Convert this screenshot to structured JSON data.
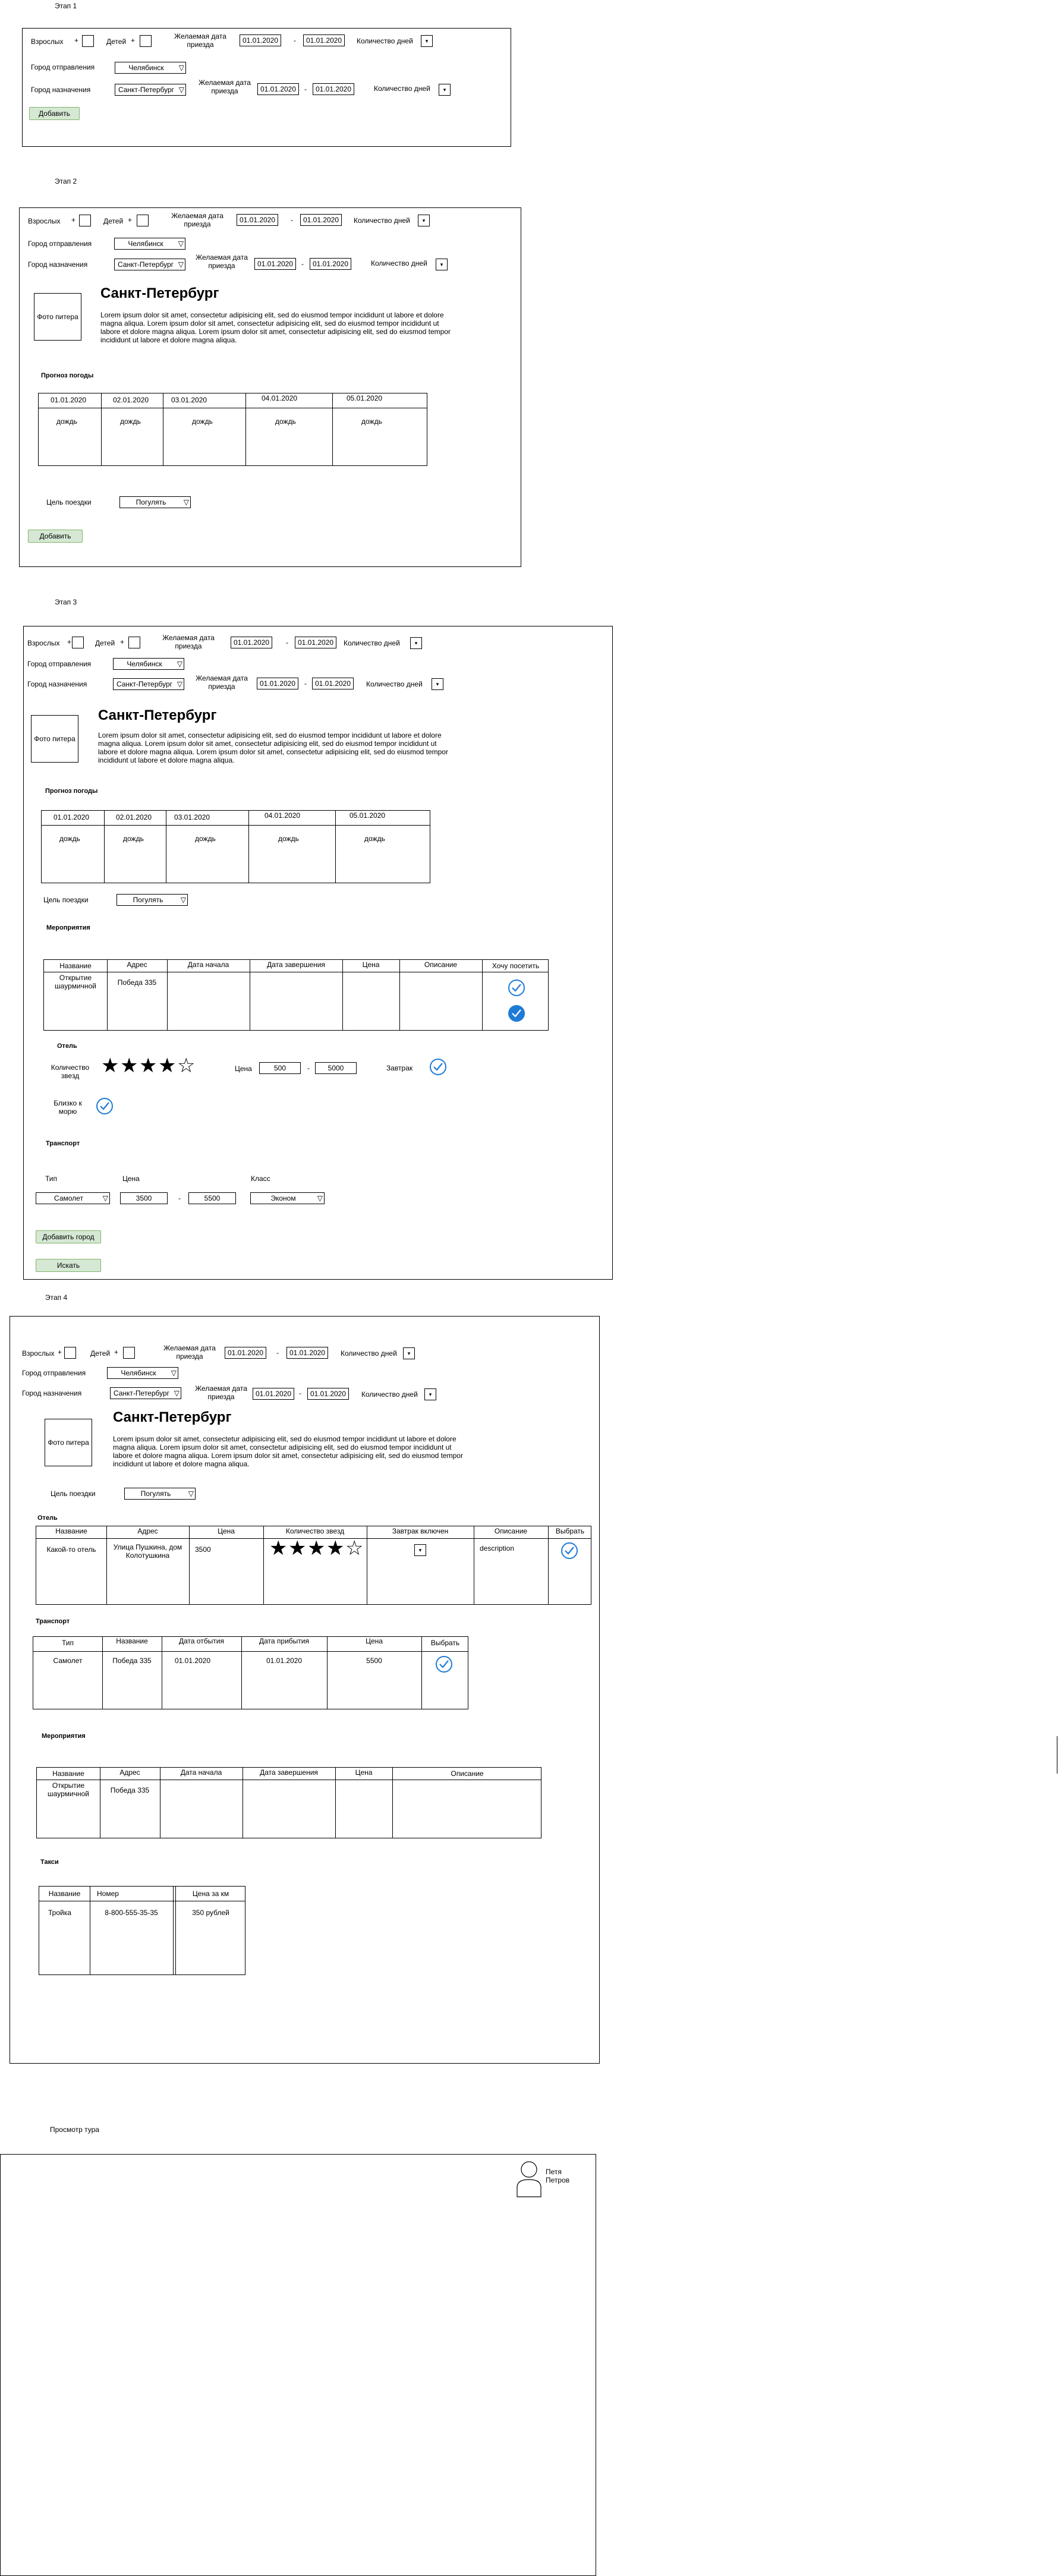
{
  "stages": [
    "Этап 1",
    "Этап 2",
    "Этап 3",
    "Этап 4",
    "Просмотр тура"
  ],
  "form": {
    "adults": "Взрослых",
    "children": "Детей",
    "plus": "+",
    "desired_date": "Желаемая дата приезда",
    "date": "01.01.2020",
    "dash": "-",
    "days_count": "Количество дней",
    "spin_arrow": "▾",
    "dep_city": "Город отправления",
    "dep_city_value": "Челябинск",
    "dest_city": "Город назначения",
    "dest_city_value": "Санкт-Петербург",
    "add_btn": "Добавить"
  },
  "city": {
    "title": "Санкт-Петербург",
    "photo": "Фото питера",
    "lorem": "Lorem ipsum dolor sit amet, consectetur adipisicing elit, sed do eiusmod tempor incididunt ut labore et dolore magna aliqua.  Lorem ipsum dolor sit amet, consectetur adipisicing elit, sed do eiusmod tempor incididunt ut labore et dolore magna aliqua. Lorem ipsum dolor sit amet, consectetur adipisicing elit, sed do eiusmod tempor incididunt ut labore et dolore magna aliqua."
  },
  "weather": {
    "heading": "Прогноз погоды",
    "dates": [
      "01.01.2020",
      "02.01.2020",
      "03.01.2020",
      "04.01.2020",
      "05.01.2020"
    ],
    "value": "дождь"
  },
  "trip": {
    "label": "Цель поездки",
    "value": "Погулять"
  },
  "events": {
    "heading": "Мероприятия",
    "cols_s3": [
      "Название",
      "Адрес",
      "Дата начала",
      "Дата завершения",
      "Цена",
      "Описание",
      "Хочу посетить"
    ],
    "cols_s4": [
      "Название",
      "Адрес",
      "Дата начала",
      "Дата завершения",
      "Цена",
      "Описание"
    ],
    "row_name": "Открытие шаурмичной",
    "row_addr": "Победа 335"
  },
  "hotel": {
    "heading": "Отель",
    "stars_label": "Количество звезд",
    "price_label": "Цена",
    "price_from": "500",
    "price_to": "5000",
    "breakfast": "Завтрак",
    "near_sea": "Близко к морю",
    "cols": [
      "Название",
      "Адрес",
      "Цена",
      "Количество звезд",
      "Завтрак включен",
      "Описание",
      "Выбрать"
    ],
    "row_name": "Какой-то отель",
    "row_addr": "Улица Пушкина, дом Колотушкина",
    "row_price": "3500",
    "row_desc": "description",
    "stars_filled": 4,
    "stars_total": 5
  },
  "transport": {
    "heading": "Транспорт",
    "type_label": "Тип",
    "type_value": "Самолет",
    "price_label": "Цена",
    "price_from": "3500",
    "price_to": "5500",
    "class_label": "Класс",
    "class_value": "Эконом",
    "cols": [
      "Тип",
      "Название",
      "Дата отбытия",
      "Дата прибытия",
      "Цена",
      "Выбрать"
    ],
    "row": [
      "Самолет",
      "Победа 335",
      "01.01.2020",
      "01.01.2020",
      "5500"
    ]
  },
  "buttons": {
    "add_city": "Добавить город",
    "search": "Искать"
  },
  "taxi": {
    "heading": "Такси",
    "cols": [
      "Название",
      "Номер",
      "Цена за км"
    ],
    "row": [
      "Тройка",
      "8-800-555-35-35",
      "350 рублей"
    ]
  },
  "tour": {
    "user": "Петя Петров"
  },
  "colors": {
    "button_fill": "#d5e8d4",
    "button_border": "#82b366",
    "check_blue": "#1e7bd6"
  }
}
